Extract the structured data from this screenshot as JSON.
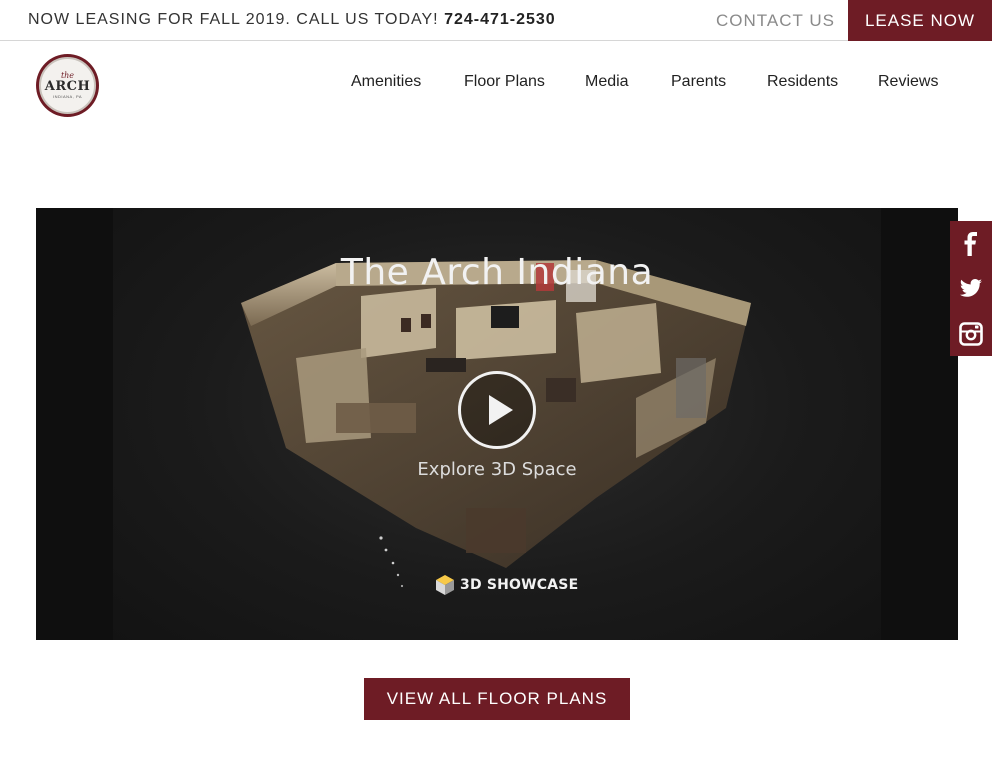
{
  "topbar": {
    "announcement": "NOW LEASING FOR FALL 2019. CALL US TODAY!",
    "phone": "724-471-2530",
    "contact_label": "CONTACT US",
    "lease_label": "LEASE NOW"
  },
  "logo": {
    "the": "the",
    "arch": "ARCH",
    "location": "INDIANA, PA"
  },
  "nav": {
    "items": [
      {
        "label": "Amenities"
      },
      {
        "label": "Floor Plans"
      },
      {
        "label": "Media"
      },
      {
        "label": "Parents"
      },
      {
        "label": "Residents"
      },
      {
        "label": "Reviews"
      }
    ]
  },
  "tour": {
    "title": "The Arch Indiana",
    "explore_label": "Explore 3D Space",
    "badge_label": "3D SHOWCASE"
  },
  "social": {
    "items": [
      {
        "icon": "facebook-icon"
      },
      {
        "icon": "twitter-icon"
      },
      {
        "icon": "instagram-icon"
      }
    ]
  },
  "cta": {
    "label": "VIEW ALL FLOOR PLANS"
  },
  "colors": {
    "brand": "#6e1c25",
    "tour_bg": "#151515"
  }
}
